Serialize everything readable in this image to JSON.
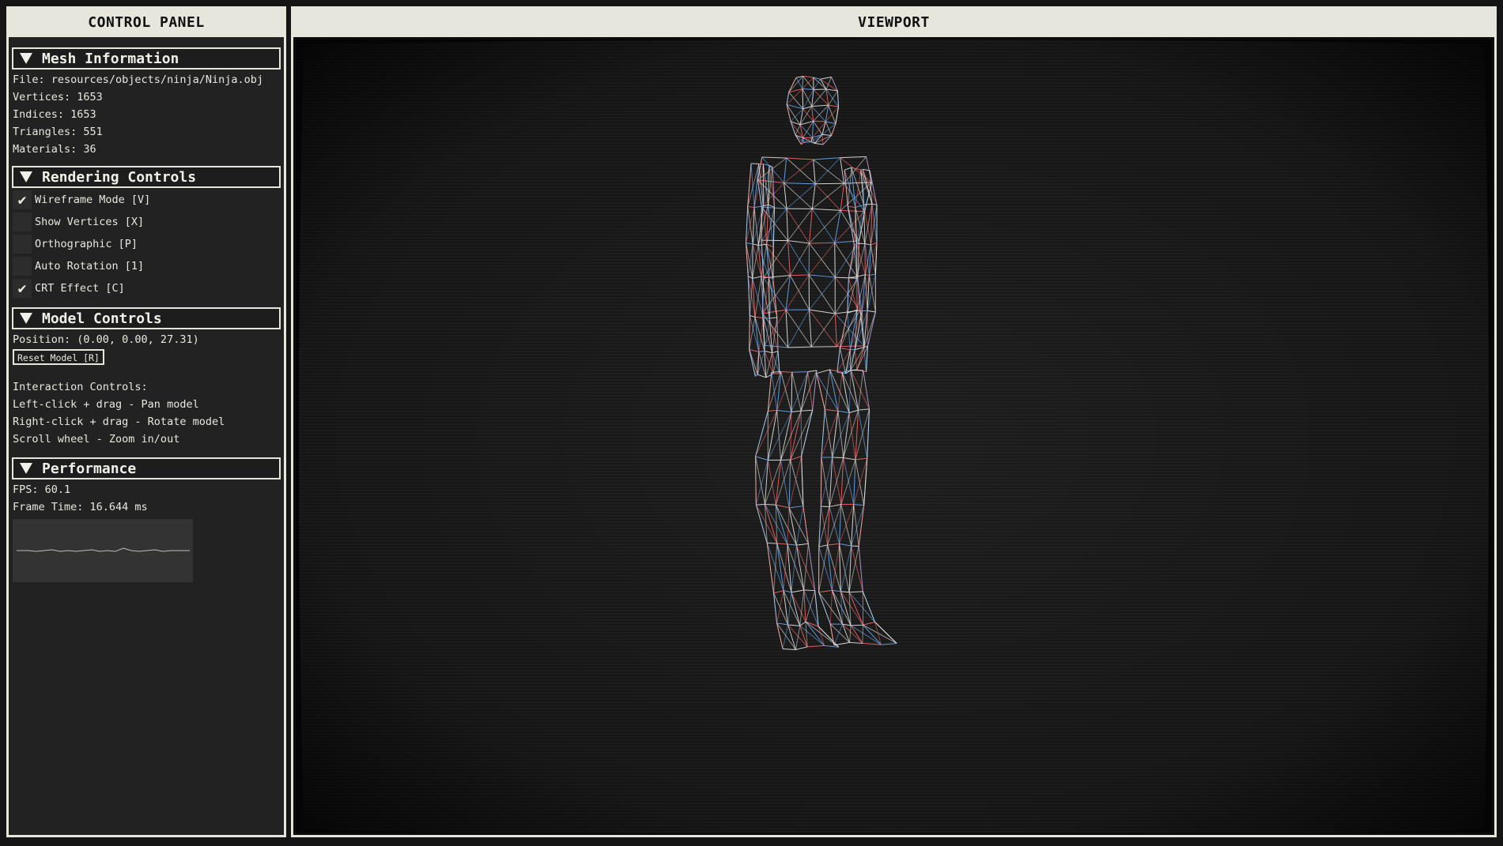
{
  "control_panel": {
    "title": "CONTROL PANEL",
    "mesh_info": {
      "header": "Mesh Information",
      "file": "File: resources/objects/ninja/Ninja.obj",
      "vertices": "Vertices: 1653",
      "indices": "Indices: 1653",
      "triangles": "Triangles: 551",
      "materials": "Materials: 36"
    },
    "rendering": {
      "header": "Rendering Controls",
      "items": [
        {
          "label": "Wireframe Mode [V]",
          "checked": true
        },
        {
          "label": "Show Vertices [X]",
          "checked": false
        },
        {
          "label": "Orthographic [P]",
          "checked": false
        },
        {
          "label": "Auto Rotation [1]",
          "checked": false
        },
        {
          "label": "CRT Effect [C]",
          "checked": true
        }
      ]
    },
    "model": {
      "header": "Model Controls",
      "position": "Position: (0.00, 0.00, 27.31)",
      "reset_button": "Reset Model [R]",
      "interaction_title": "Interaction Controls:",
      "interaction_lines": [
        "Left-click + drag - Pan model",
        "Right-click + drag - Rotate model",
        "Scroll wheel - Zoom in/out"
      ]
    },
    "performance": {
      "header": "Performance",
      "fps": "FPS: 60.1",
      "frame_time": "Frame Time: 16.644 ms"
    }
  },
  "viewport": {
    "title": "VIEWPORT",
    "model_name": "Ninja",
    "wireframe_color": "#e8e8e8",
    "background": "#1c1c1c"
  },
  "icons": {
    "collapse": "triangle-down-icon",
    "check": "checkmark-icon"
  }
}
